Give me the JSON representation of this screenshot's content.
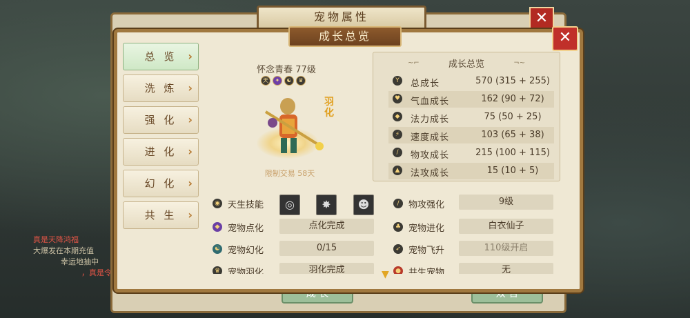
{
  "background": {
    "back_window_title": "宠物属性",
    "back_close": "✕",
    "back_buttons": [
      "成 长",
      "双 合"
    ],
    "chat_lines": [
      "真是天降鸿福",
      "大爆发在本期充值",
      "幸运地抽中",
      "，真是令"
    ]
  },
  "panel": {
    "title": "成长总览",
    "close": "✕"
  },
  "sidebar": {
    "items": [
      {
        "label": "总 览",
        "active": true
      },
      {
        "label": "洗 炼",
        "active": false
      },
      {
        "label": "强 化",
        "active": false
      },
      {
        "label": "进 化",
        "active": false
      },
      {
        "label": "幻 化",
        "active": false
      },
      {
        "label": "共 生",
        "active": false
      }
    ],
    "chevron": "›"
  },
  "pet": {
    "name": "怀念青春 77级",
    "badges": [
      "天",
      "✦",
      "☯",
      "♛"
    ],
    "feather_label": "羽化",
    "trade_limit": "限制交易 58天"
  },
  "growth": {
    "title": "成长总览",
    "rows": [
      {
        "label": "总成长",
        "value": "570 (315 + 255)",
        "icon": "Y"
      },
      {
        "label": "气血成长",
        "value": "162 (90 + 72)",
        "icon": "♥"
      },
      {
        "label": "法力成长",
        "value": "75 (50 + 25)",
        "icon": "◆"
      },
      {
        "label": "速度成长",
        "value": "103 (65 + 38)",
        "icon": "⚡"
      },
      {
        "label": "物攻成长",
        "value": "215 (100 + 115)",
        "icon": "/"
      },
      {
        "label": "法攻成长",
        "value": "15 (10 + 5)",
        "icon": "▲"
      }
    ]
  },
  "attributes": {
    "innate_skill_label": "天生技能",
    "skills": [
      "◎",
      "✸",
      "☻"
    ],
    "left": [
      {
        "label": "宠物点化",
        "value": "点化完成"
      },
      {
        "label": "宠物幻化",
        "value": "0/15"
      },
      {
        "label": "宠物羽化",
        "value": "羽化完成"
      }
    ],
    "right": [
      {
        "label": "物攻强化",
        "value": "9级"
      },
      {
        "label": "宠物进化",
        "value": "白衣仙子"
      },
      {
        "label": "宠物飞升",
        "value": "110级开启"
      },
      {
        "label": "共生宠物",
        "value": "无"
      }
    ]
  },
  "scroll_indicator": "▼"
}
